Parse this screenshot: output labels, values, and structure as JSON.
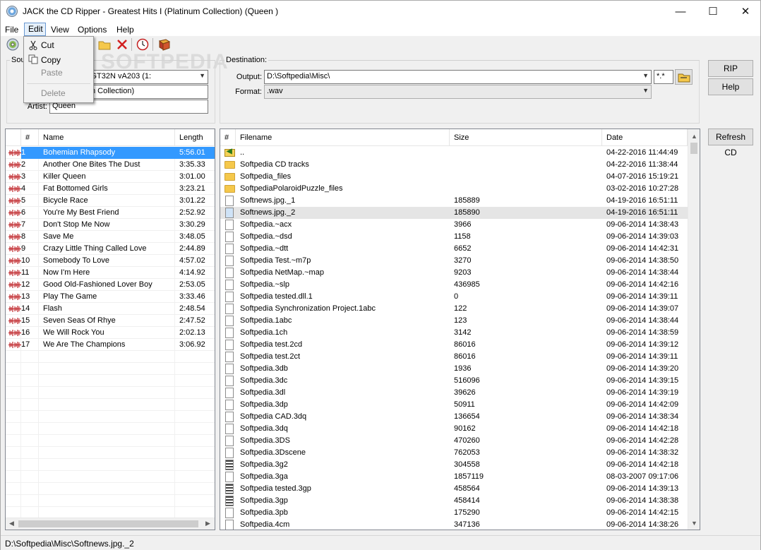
{
  "window": {
    "title": "JACK the CD Ripper - Greatest Hits I (Platinum  Collection) (Queen )",
    "minimize": "—",
    "maximize": "☐",
    "close": "✕"
  },
  "menu": [
    "File",
    "Edit",
    "View",
    "Options",
    "Help"
  ],
  "edit_menu": {
    "cut": "Cut",
    "copy": "Copy",
    "paste": "Paste",
    "delete": "Delete"
  },
  "watermark": "SOFTPEDIA",
  "source": {
    "label": "Sou",
    "drive": "DVD+-RW GT32N   vA203 (1:",
    "album": "s I (Platinum  Collection)",
    "artist_label": "Artist:",
    "artist": "Queen"
  },
  "destination": {
    "label": "Destination:",
    "output_label": "Output:",
    "output_value": "D:\\Softpedia\\Misc\\",
    "mask_value": "*.*",
    "format_label": "Format:",
    "format_value": ".wav"
  },
  "buttons": {
    "rip": "RIP",
    "help": "Help",
    "refresh": "Refresh CD"
  },
  "tracks": {
    "headers": [
      "#",
      "Name",
      "Length"
    ],
    "rows": [
      {
        "num": "1",
        "name": "Bohemian Rhapsody",
        "length": "5:56.01"
      },
      {
        "num": "2",
        "name": "Another One Bites The Dust",
        "length": "3:35.33"
      },
      {
        "num": "3",
        "name": "Killer Queen",
        "length": "3:01.00"
      },
      {
        "num": "4",
        "name": "Fat Bottomed Girls",
        "length": "3:23.21"
      },
      {
        "num": "5",
        "name": "Bicycle Race",
        "length": "3:01.22"
      },
      {
        "num": "6",
        "name": "You're My Best Friend",
        "length": "2:52.92"
      },
      {
        "num": "7",
        "name": "Don't Stop Me Now",
        "length": "3:30.29"
      },
      {
        "num": "8",
        "name": "Save Me",
        "length": "3:48.05"
      },
      {
        "num": "9",
        "name": "Crazy Little Thing Called Love",
        "length": "2:44.89"
      },
      {
        "num": "10",
        "name": "Somebody To Love",
        "length": "4:57.02"
      },
      {
        "num": "11",
        "name": "Now I'm Here",
        "length": "4:14.92"
      },
      {
        "num": "12",
        "name": "Good Old-Fashioned Lover Boy",
        "length": "2:53.05"
      },
      {
        "num": "13",
        "name": "Play The Game",
        "length": "3:33.46"
      },
      {
        "num": "14",
        "name": "Flash",
        "length": "2:48.54"
      },
      {
        "num": "15",
        "name": "Seven Seas Of Rhye",
        "length": "2:47.52"
      },
      {
        "num": "16",
        "name": "We Will Rock You",
        "length": "2:02.13"
      },
      {
        "num": "17",
        "name": "We Are The Champions",
        "length": "3:06.92"
      }
    ]
  },
  "files": {
    "headers": [
      "#",
      "Filename",
      "Size",
      "Date"
    ],
    "rows": [
      {
        "icon": "up-folder-icon",
        "name": "..",
        "size": "",
        "date": "04-22-2016 11:44:49"
      },
      {
        "icon": "folder-icon",
        "name": "Softpedia CD tracks",
        "size": "",
        "date": "04-22-2016 11:38:44"
      },
      {
        "icon": "folder-icon",
        "name": "Softpedia_files",
        "size": "",
        "date": "04-07-2016 15:19:21"
      },
      {
        "icon": "folder-icon",
        "name": "SoftpediaPolaroidPuzzle_files",
        "size": "",
        "date": "03-02-2016 10:27:28"
      },
      {
        "icon": "file-icon",
        "name": "Softnews.jpg._1",
        "size": "185889",
        "date": "04-19-2016 16:51:11"
      },
      {
        "icon": "file-icon",
        "name": "Softnews.jpg._2",
        "size": "185890",
        "date": "04-19-2016 16:51:11"
      },
      {
        "icon": "file-icon",
        "name": "Softpedia.~acx",
        "size": "3966",
        "date": "09-06-2014 14:38:43"
      },
      {
        "icon": "file-icon",
        "name": "Softpedia.~dsd",
        "size": "1158",
        "date": "09-06-2014 14:39:03"
      },
      {
        "icon": "file-icon",
        "name": "Softpedia.~dtt",
        "size": "6652",
        "date": "09-06-2014 14:42:31"
      },
      {
        "icon": "file-icon",
        "name": "Softpedia Test.~m7p",
        "size": "3270",
        "date": "09-06-2014 14:38:50"
      },
      {
        "icon": "file-icon",
        "name": "Softpedia NetMap.~map",
        "size": "9203",
        "date": "09-06-2014 14:38:44"
      },
      {
        "icon": "file-icon",
        "name": "Softpedia.~slp",
        "size": "436985",
        "date": "09-06-2014 14:42:16"
      },
      {
        "icon": "file-icon",
        "name": "Softpedia tested.dll.1",
        "size": "0",
        "date": "09-06-2014 14:39:11"
      },
      {
        "icon": "file-icon",
        "name": "Softpedia Synchronization Project.1abc",
        "size": "122",
        "date": "09-06-2014 14:39:07"
      },
      {
        "icon": "file-icon",
        "name": "Softpedia.1abc",
        "size": "123",
        "date": "09-06-2014 14:38:44"
      },
      {
        "icon": "file-icon",
        "name": "Softpedia.1ch",
        "size": "3142",
        "date": "09-06-2014 14:38:59"
      },
      {
        "icon": "file-icon",
        "name": "Softpedia test.2cd",
        "size": "86016",
        "date": "09-06-2014 14:39:12"
      },
      {
        "icon": "file-icon",
        "name": "Softpedia test.2ct",
        "size": "86016",
        "date": "09-06-2014 14:39:11"
      },
      {
        "icon": "file-icon",
        "name": "Softpedia.3db",
        "size": "1936",
        "date": "09-06-2014 14:39:20"
      },
      {
        "icon": "file-icon",
        "name": "Softpedia.3dc",
        "size": "516096",
        "date": "09-06-2014 14:39:15"
      },
      {
        "icon": "file-icon",
        "name": "Softpedia.3dl",
        "size": "39626",
        "date": "09-06-2014 14:39:19"
      },
      {
        "icon": "file-icon",
        "name": "Softpedia.3dp",
        "size": "50911",
        "date": "09-06-2014 14:42:09"
      },
      {
        "icon": "file-icon",
        "name": "Softpedia CAD.3dq",
        "size": "136654",
        "date": "09-06-2014 14:38:34"
      },
      {
        "icon": "file-icon",
        "name": "Softpedia.3dq",
        "size": "90162",
        "date": "09-06-2014 14:42:18"
      },
      {
        "icon": "file-icon",
        "name": "Softpedia.3DS",
        "size": "470260",
        "date": "09-06-2014 14:42:28"
      },
      {
        "icon": "file-icon",
        "name": "Softpedia.3Dscene",
        "size": "762053",
        "date": "09-06-2014 14:38:32"
      },
      {
        "icon": "video-file-icon",
        "name": "Softpedia.3g2",
        "size": "304558",
        "date": "09-06-2014 14:42:18"
      },
      {
        "icon": "file-icon",
        "name": "Softpedia.3ga",
        "size": "1857119",
        "date": "08-03-2007 09:17:06"
      },
      {
        "icon": "video-file-icon",
        "name": "Softpedia tested.3gp",
        "size": "458564",
        "date": "09-06-2014 14:39:13"
      },
      {
        "icon": "video-file-icon",
        "name": "Softpedia.3gp",
        "size": "458414",
        "date": "09-06-2014 14:38:38"
      },
      {
        "icon": "file-icon",
        "name": "Softpedia.3pb",
        "size": "175290",
        "date": "09-06-2014 14:42:15"
      },
      {
        "icon": "file-icon",
        "name": "Softpedia.4cm",
        "size": "347136",
        "date": "09-06-2014 14:38:26"
      }
    ]
  },
  "status": "D:\\Softpedia\\Misc\\Softnews.jpg._2",
  "colors": {
    "selection": "#3399ff",
    "hover_row": "#e5e5e5",
    "wave_icon": "#c0282d"
  }
}
